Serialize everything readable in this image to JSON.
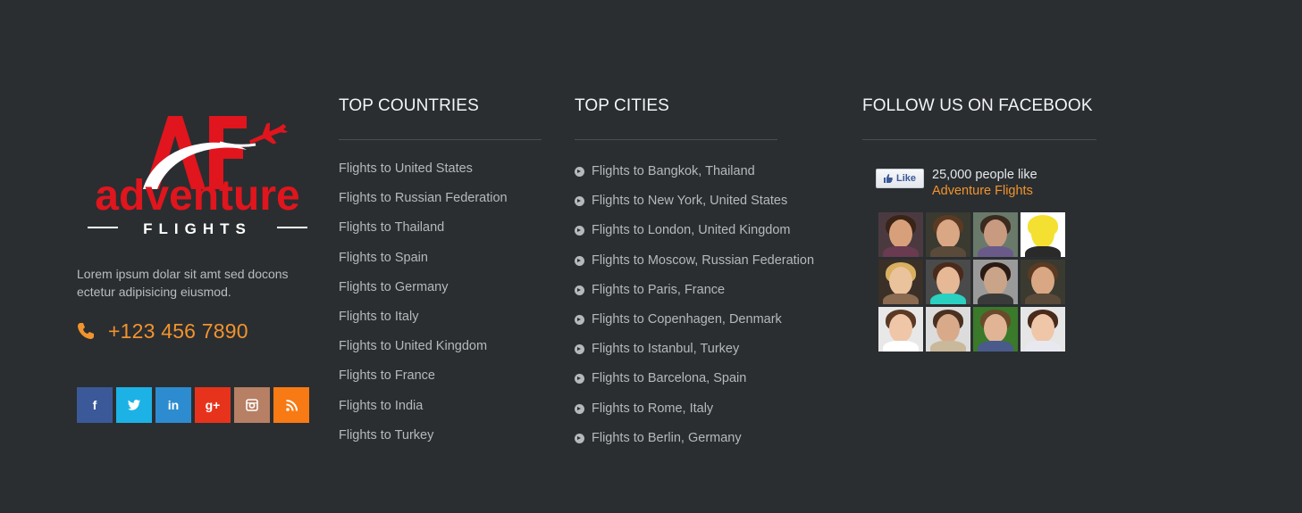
{
  "brand": {
    "logo_mark": "AF",
    "logo_name": "adventure",
    "logo_sub": "FLIGHTS",
    "tagline": "Lorem ipsum dolar sit amt sed docons ectetur adipisicing eiusmod.",
    "phone_icon": "phone-icon",
    "phone": "+123 456 7890",
    "socials": [
      {
        "name": "facebook",
        "glyph": "f",
        "color": "#3b5998"
      },
      {
        "name": "twitter",
        "glyph": "t",
        "color": "#1db2e6"
      },
      {
        "name": "linkedin",
        "glyph": "in",
        "color": "#2d8ccf"
      },
      {
        "name": "google-plus",
        "glyph": "g+",
        "color": "#e8331c"
      },
      {
        "name": "instagram",
        "glyph": "◎",
        "color": "#b77f64"
      },
      {
        "name": "rss",
        "glyph": "≈",
        "color": "#f87a14"
      }
    ]
  },
  "countries": {
    "title": "TOP COUNTRIES",
    "links": [
      "Flights to United States",
      "Flights to Russian Federation",
      "Flights to Thailand",
      "Flights to Spain",
      "Flights to Germany",
      "Flights to Italy",
      "Flights to United Kingdom",
      "Flights to France",
      "Flights to India",
      "Flights to Turkey"
    ]
  },
  "cities": {
    "title": "TOP CITIES",
    "links": [
      "Flights to Bangkok, Thailand",
      "Flights to New York, United States",
      "Flights to London, United Kingdom",
      "Flights to Moscow, Russian Federation",
      "Flights to Paris, France",
      "Flights to Copenhagen, Denmark",
      "Flights to Istanbul, Turkey",
      "Flights to Barcelona, Spain",
      "Flights to Rome, Italy",
      "Flights to Berlin, Germany"
    ]
  },
  "facebook": {
    "title": "FOLLOW US ON FACEBOOK",
    "like_label": "Like",
    "count_text": "25,000 people like",
    "page_name": "Adventure Flights",
    "faces": [
      {
        "bg": "#4a3a40",
        "skin": "#d8a07a",
        "hair": "#3a2418",
        "shirt": "#6a3a50"
      },
      {
        "bg": "#3a3a30",
        "skin": "#d9a784",
        "hair": "#5a3a22",
        "shirt": "#5a4a3a"
      },
      {
        "bg": "#6a7a6a",
        "skin": "#c89a80",
        "hair": "#3a2a20",
        "shirt": "#6a5a8a"
      },
      {
        "bg": "#ffffff",
        "skin": "#f4e030",
        "hair": "#f4e030",
        "shirt": "#2a2a2a"
      },
      {
        "bg": "#3a3028",
        "skin": "#eac29c",
        "hair": "#d9b060",
        "shirt": "#8a6a50"
      },
      {
        "bg": "#4a4a4a",
        "skin": "#e6b896",
        "hair": "#4a2a1a",
        "shirt": "#2ad0c0"
      },
      {
        "bg": "#9a9a9a",
        "skin": "#c9a488",
        "hair": "#2a1a14",
        "shirt": "#3a3a3a"
      },
      {
        "bg": "#3a3a30",
        "skin": "#d9a784",
        "hair": "#5a3a22",
        "shirt": "#5a4a3a"
      },
      {
        "bg": "#e8e8e8",
        "skin": "#efc6a8",
        "hair": "#5a3a24",
        "shirt": "#ffffff"
      },
      {
        "bg": "#dcdcdc",
        "skin": "#d9aa8a",
        "hair": "#4a3020",
        "shirt": "#c9b89a"
      },
      {
        "bg": "#3a7a2a",
        "skin": "#e0b494",
        "hair": "#6a4a2a",
        "shirt": "#4a5a8a"
      },
      {
        "bg": "#e6e6e6",
        "skin": "#efc6a8",
        "hair": "#4a2a1a",
        "shirt": "#e8e8f0"
      }
    ]
  },
  "colors": {
    "background": "#2a2e31",
    "accent": "#f2932d",
    "logo_red": "#e0151d"
  }
}
